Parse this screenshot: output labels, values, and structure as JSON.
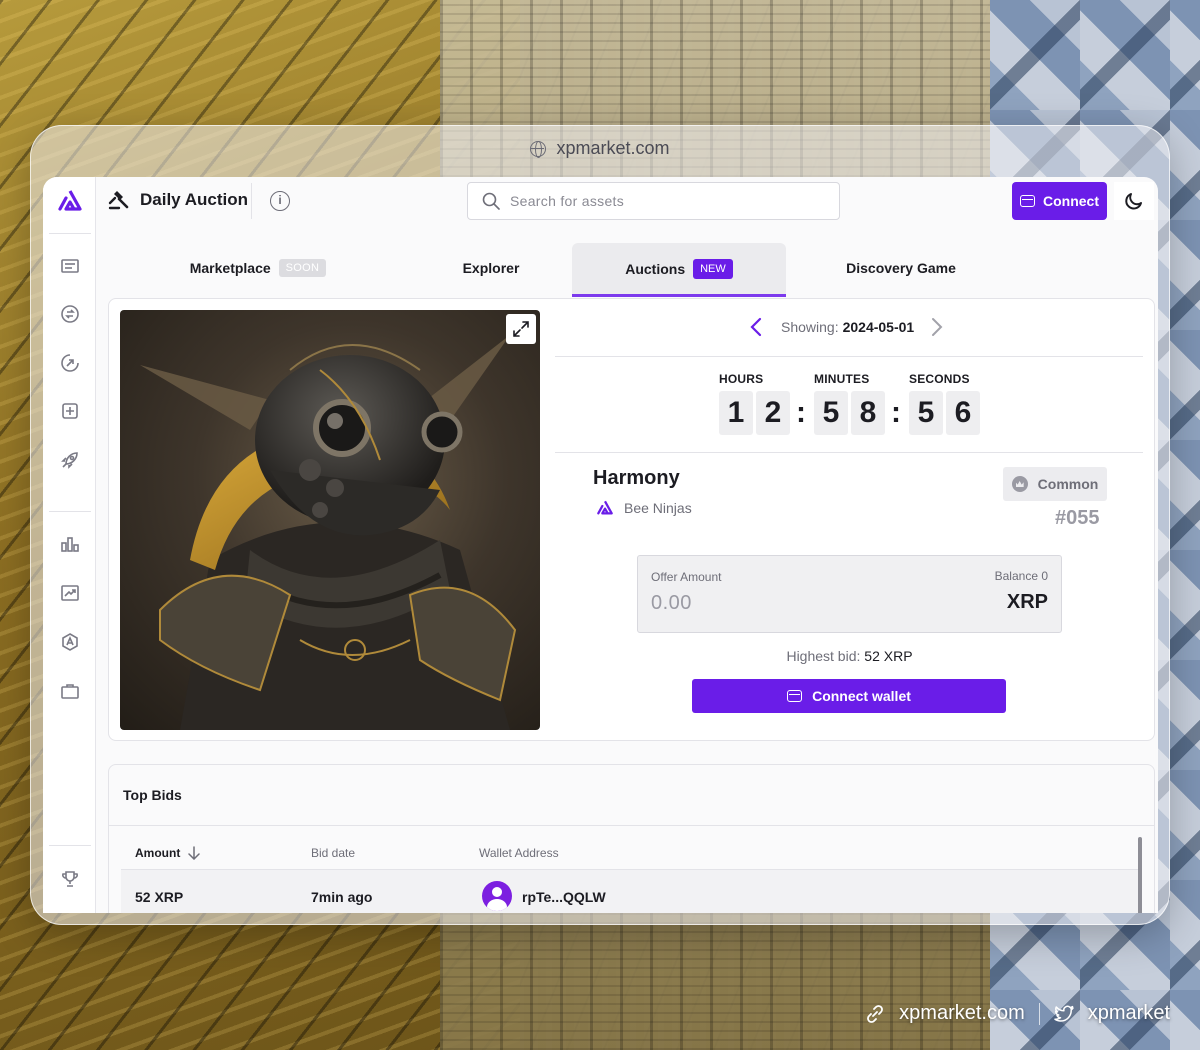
{
  "browser": {
    "url": "xpmarket.com"
  },
  "header": {
    "title": "Daily Auction",
    "search_placeholder": "Search for assets",
    "connect_label": "Connect"
  },
  "tabs": [
    {
      "label": "Marketplace",
      "badge": "SOON"
    },
    {
      "label": "Explorer"
    },
    {
      "label": "Auctions",
      "badge": "NEW",
      "active": true
    },
    {
      "label": "Discovery Game"
    }
  ],
  "auction": {
    "showing_label": "Showing:",
    "showing_date": "2024-05-01",
    "timer": {
      "hours_label": "HOURS",
      "minutes_label": "MINUTES",
      "seconds_label": "SECONDS",
      "digits": [
        "1",
        "2",
        "5",
        "8",
        "5",
        "6"
      ]
    },
    "nft_name": "Harmony",
    "collection": "Bee Ninjas",
    "rarity": "Common",
    "token_number": "#055",
    "offer": {
      "label": "Offer Amount",
      "balance": "Balance 0",
      "placeholder": "0.00",
      "currency": "XRP"
    },
    "highest_bid_label": "Highest bid:",
    "highest_bid_value": "52 XRP",
    "connect_wallet_label": "Connect wallet"
  },
  "top_bids": {
    "title": "Top Bids",
    "columns": [
      "Amount",
      "Bid date",
      "Wallet Address"
    ],
    "rows": [
      {
        "amount": "52 XRP",
        "date": "7min ago",
        "wallet": "rpTe...QQLW"
      }
    ]
  },
  "footer": {
    "site": "xpmarket.com",
    "twitter": "xpmarket"
  },
  "colors": {
    "accent": "#6a1de8",
    "tab_underline": "#7c3aed"
  },
  "icons": {
    "sidebar": [
      "news-icon",
      "swap-icon",
      "explore-icon",
      "create-icon",
      "launch-icon",
      "chart-bars-icon",
      "trending-icon",
      "token-icon",
      "portfolio-icon",
      "trophy-icon"
    ]
  }
}
